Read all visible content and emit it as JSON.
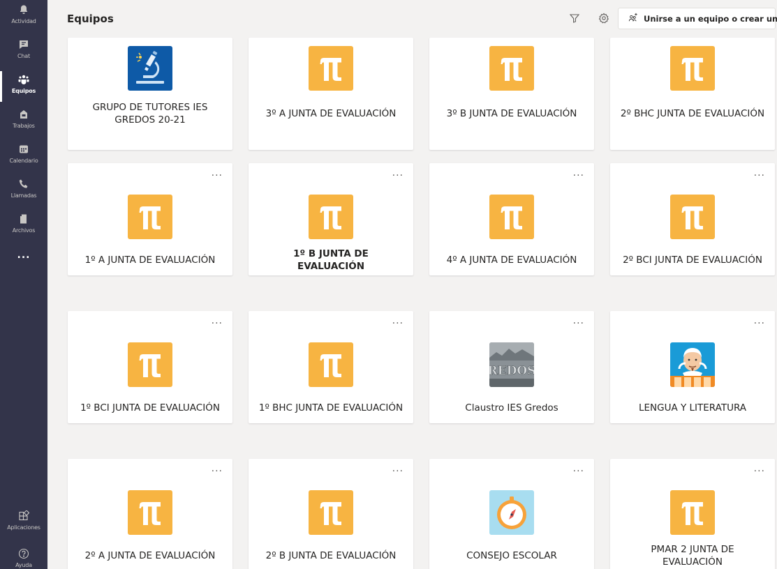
{
  "app": {
    "rail": {
      "items": [
        {
          "label": "Actividad",
          "icon": "bell-icon"
        },
        {
          "label": "Chat",
          "icon": "chat-icon"
        },
        {
          "label": "Equipos",
          "icon": "teams-icon",
          "active": true
        },
        {
          "label": "Trabajos",
          "icon": "assignments-icon"
        },
        {
          "label": "Calendario",
          "icon": "calendar-icon"
        },
        {
          "label": "Llamadas",
          "icon": "phone-icon"
        },
        {
          "label": "Archivos",
          "icon": "files-icon"
        }
      ],
      "more": "...",
      "apps_label": "Aplicaciones",
      "help_label": "Ayuda"
    },
    "header": {
      "title": "Equipos",
      "filter_icon": "filter-icon",
      "settings_icon": "settings-icon",
      "join_button": "Unirse a un equipo o crear uno"
    },
    "colors": {
      "rail_bg": "#33344a",
      "page_bg": "#f3f2f1",
      "tile_orange": "#f7b442",
      "tile_blue": "#0e5aa7"
    },
    "teams": [
      {
        "name": "GRUPO DE TUTORES IES GREDOS 20-21",
        "avatar": "microscope-icon"
      },
      {
        "name": "3º A JUNTA DE EVALUACIÓN",
        "avatar": "pi-icon"
      },
      {
        "name": "3º B JUNTA DE EVALUACIÓN",
        "avatar": "pi-icon"
      },
      {
        "name": "2º BHC JUNTA DE EVALUACIÓN",
        "avatar": "pi-icon"
      },
      {
        "name": "1º A JUNTA DE EVALUACIÓN",
        "avatar": "pi-icon"
      },
      {
        "name": "1º B JUNTA DE EVALUACIÓN",
        "avatar": "pi-icon",
        "bold": true
      },
      {
        "name": "4º A JUNTA DE EVALUACIÓN",
        "avatar": "pi-icon"
      },
      {
        "name": "2º BCI JUNTA DE EVALUACIÓN",
        "avatar": "pi-icon"
      },
      {
        "name": "1º BCI JUNTA DE EVALUACIÓN",
        "avatar": "pi-icon"
      },
      {
        "name": "1º BHC JUNTA DE EVALUACIÓN",
        "avatar": "pi-icon"
      },
      {
        "name": "Claustro IES Gredos",
        "avatar": "gredos-photo-icon"
      },
      {
        "name": "LENGUA Y LITERATURA",
        "avatar": "shakespeare-icon"
      },
      {
        "name": "2º A JUNTA DE EVALUACIÓN",
        "avatar": "pi-icon"
      },
      {
        "name": "2º B JUNTA DE EVALUACIÓN",
        "avatar": "pi-icon"
      },
      {
        "name": "CONSEJO ESCOLAR",
        "avatar": "compass-icon"
      },
      {
        "name": "PMAR 2 JUNTA DE EVALUACIÓN",
        "avatar": "pi-icon"
      }
    ],
    "card_more": "..."
  }
}
